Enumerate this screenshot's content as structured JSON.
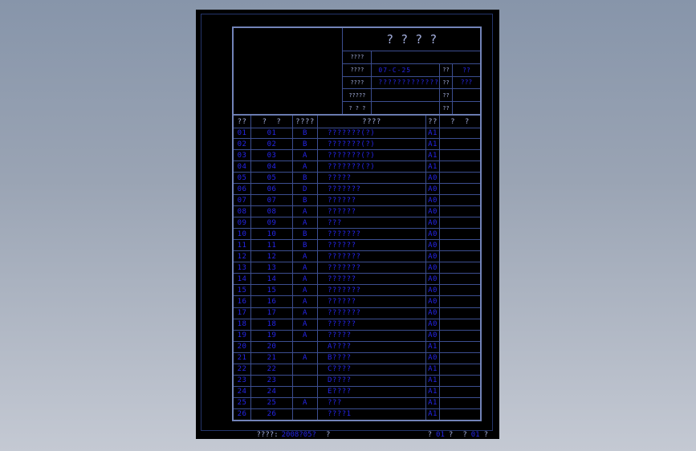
{
  "colors": {
    "background_top": "#8795aa",
    "background_bottom": "#c4c9d3",
    "viewport_background": "#000000",
    "frame_navy": "#24356b",
    "grid_line": "#3c4e90",
    "border_thick": "#7283b8",
    "label_text": "#a3aedd",
    "value_text": "#2525e8"
  },
  "viewport": {
    "title_block": {
      "title": "????",
      "rows": [
        {
          "label": "????",
          "value": ""
        },
        {
          "label": "????",
          "value": "07-C-25",
          "label2": "??",
          "value2": "??"
        },
        {
          "label": "????",
          "value": "?????????????",
          "label2": "??",
          "value2": "???"
        },
        {
          "label": "?????",
          "value": "",
          "label2": "??",
          "value2": ""
        },
        {
          "label": "? ? ?",
          "value": "",
          "label2": "??",
          "value2": ""
        }
      ]
    },
    "table": {
      "headers": [
        "??",
        "?  ?",
        "????",
        "????",
        "??",
        "?  ?"
      ],
      "rows": [
        [
          "01",
          "01",
          "B",
          "???????(?)",
          "A1",
          ""
        ],
        [
          "02",
          "02",
          "B",
          "???????(?)",
          "A1",
          ""
        ],
        [
          "03",
          "03",
          "A",
          "???????(?)",
          "A1",
          ""
        ],
        [
          "04",
          "04",
          "A",
          "???????(?)",
          "A1",
          ""
        ],
        [
          "05",
          "05",
          "B",
          "?????",
          "A0",
          ""
        ],
        [
          "06",
          "06",
          "D",
          "???????",
          "A0",
          ""
        ],
        [
          "07",
          "07",
          "B",
          "??????",
          "A0",
          ""
        ],
        [
          "08",
          "08",
          "A",
          "??????",
          "A0",
          ""
        ],
        [
          "09",
          "09",
          "A",
          "???",
          "A0",
          ""
        ],
        [
          "10",
          "10",
          "B",
          "???????",
          "A0",
          ""
        ],
        [
          "11",
          "11",
          "B",
          "??????",
          "A0",
          ""
        ],
        [
          "12",
          "12",
          "A",
          "???????",
          "A0",
          ""
        ],
        [
          "13",
          "13",
          "A",
          "???????",
          "A0",
          ""
        ],
        [
          "14",
          "14",
          "A",
          "??????",
          "A0",
          ""
        ],
        [
          "15",
          "15",
          "A",
          "???????",
          "A0",
          ""
        ],
        [
          "16",
          "16",
          "A",
          "??????",
          "A0",
          ""
        ],
        [
          "17",
          "17",
          "A",
          "???????",
          "A0",
          ""
        ],
        [
          "18",
          "18",
          "A",
          "??????",
          "A0",
          ""
        ],
        [
          "19",
          "19",
          "A",
          "?????",
          "A0",
          ""
        ],
        [
          "20",
          "20",
          "",
          "A????",
          "A1",
          ""
        ],
        [
          "21",
          "21",
          "A",
          "B????",
          "A0",
          ""
        ],
        [
          "22",
          "22",
          "",
          "C????",
          "A1",
          ""
        ],
        [
          "23",
          "23",
          "",
          "D????",
          "A1",
          ""
        ],
        [
          "24",
          "24",
          "",
          "E????",
          "A1",
          ""
        ],
        [
          "25",
          "25",
          "A",
          "???",
          "A1",
          ""
        ],
        [
          "26",
          "26",
          "",
          "????1",
          "A1",
          ""
        ]
      ]
    },
    "footer": {
      "left_label": "????:",
      "left_value": "2008?05?",
      "left_suffix": "?",
      "right_parts": [
        "?",
        "01",
        "?",
        "?",
        "01",
        "?"
      ]
    }
  }
}
